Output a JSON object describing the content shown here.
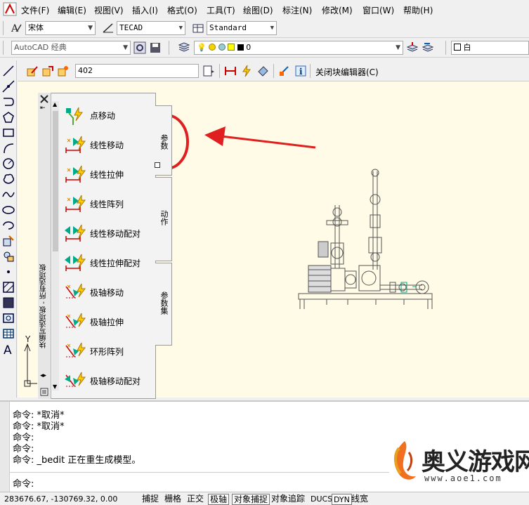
{
  "menubar": {
    "items": [
      "文件(F)",
      "编辑(E)",
      "视图(V)",
      "插入(I)",
      "格式(O)",
      "工具(T)",
      "绘图(D)",
      "标注(N)",
      "修改(M)",
      "窗口(W)",
      "帮助(H)"
    ]
  },
  "toolbar1": {
    "font_value": "宋体",
    "style_value": "TECAD",
    "table_style_value": "Standard"
  },
  "toolbar2": {
    "workspace_value": "AutoCAD 经典",
    "layer_value": "0",
    "color_value": "白"
  },
  "block_editor": {
    "name_value": "402",
    "close_label": "关闭块编辑器(C)"
  },
  "palette": {
    "title": "块编写选项板 - 所有选项板",
    "items": [
      {
        "label": "点移动"
      },
      {
        "label": "线性移动"
      },
      {
        "label": "线性拉伸"
      },
      {
        "label": "线性阵列"
      },
      {
        "label": "线性移动配对"
      },
      {
        "label": "线性拉伸配对"
      },
      {
        "label": "极轴移动"
      },
      {
        "label": "极轴拉伸"
      },
      {
        "label": "环形阵列"
      },
      {
        "label": "极轴移动配对"
      }
    ],
    "tabs": [
      {
        "label": "参数"
      },
      {
        "label": "动作"
      },
      {
        "label": "参数集"
      }
    ]
  },
  "ucs": {
    "y_label": "Y"
  },
  "command": {
    "lines": [
      "命令: *取消*",
      "命令: *取消*",
      "命令:",
      "命令:",
      "命令: _bedit 正在重生成模型。"
    ],
    "prompt": "命令:"
  },
  "statusbar": {
    "coords": "283676.67, -130769.32, 0.00",
    "buttons": [
      {
        "label": "捕捉",
        "on": false
      },
      {
        "label": "栅格",
        "on": false
      },
      {
        "label": "正交",
        "on": false
      },
      {
        "label": "极轴",
        "on": true
      },
      {
        "label": "对象捕捉",
        "on": true
      },
      {
        "label": "对象追踪",
        "on": false
      },
      {
        "label": "DUCS",
        "on": false
      },
      {
        "label": "DYN",
        "on": true
      },
      {
        "label": "线宽",
        "on": false
      }
    ]
  },
  "watermark": {
    "text": "奥义游戏网",
    "url": "www.aoe1.com"
  },
  "colors": {
    "canvas": "#fffbe6",
    "annotation": "#e02020"
  }
}
